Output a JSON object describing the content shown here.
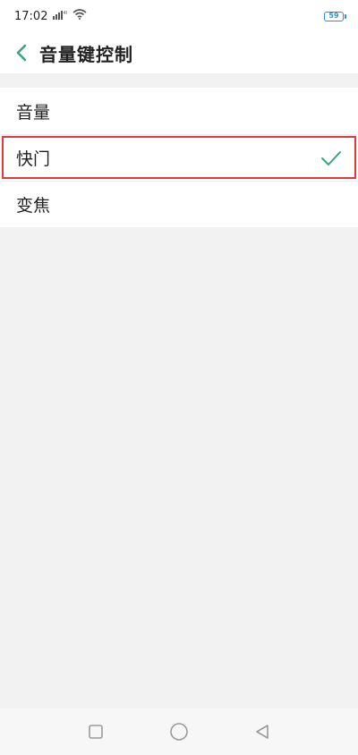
{
  "status_bar": {
    "time": "17:02",
    "battery": "59",
    "battery_color": "#2c8fd6"
  },
  "header": {
    "title": "音量键控制",
    "back_icon": "chevron-left-icon",
    "accent_color": "#3aa57a"
  },
  "options": [
    {
      "label": "音量",
      "selected": false
    },
    {
      "label": "快门",
      "selected": true
    },
    {
      "label": "变焦",
      "selected": false
    }
  ],
  "nav_bar": {
    "icons": [
      "square-icon",
      "circle-icon",
      "triangle-back-icon"
    ]
  }
}
